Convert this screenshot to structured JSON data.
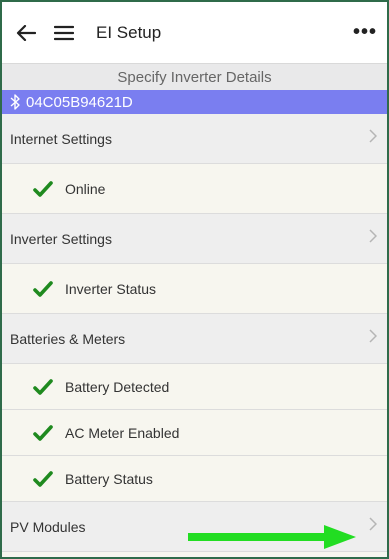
{
  "appbar": {
    "title": "EI Setup",
    "more": "•••"
  },
  "subheader": "Specify Inverter Details",
  "device": {
    "id": "04C05B94621D"
  },
  "rows": [
    {
      "type": "section",
      "label": "Internet Settings",
      "chevron": ">"
    },
    {
      "type": "item",
      "label": "Online",
      "status": "ok"
    },
    {
      "type": "section",
      "label": "Inverter Settings",
      "chevron": ">"
    },
    {
      "type": "item",
      "label": "Inverter Status",
      "status": "ok"
    },
    {
      "type": "section",
      "label": "Batteries & Meters",
      "chevron": ">"
    },
    {
      "type": "item",
      "label": "Battery Detected",
      "status": "ok"
    },
    {
      "type": "item",
      "label": "AC Meter Enabled",
      "status": "ok"
    },
    {
      "type": "item",
      "label": "Battery Status",
      "status": "ok"
    },
    {
      "type": "section",
      "label": "PV Modules",
      "chevron": ">"
    }
  ],
  "colors": {
    "device_bar": "#7a7ef0",
    "check_green": "#1f8a1f",
    "annotation_arrow": "#22dd22"
  },
  "icons": [
    "back-arrow-icon",
    "hamburger-menu-icon",
    "more-options-icon",
    "bluetooth-icon",
    "checkmark-icon",
    "chevron-right-icon"
  ]
}
